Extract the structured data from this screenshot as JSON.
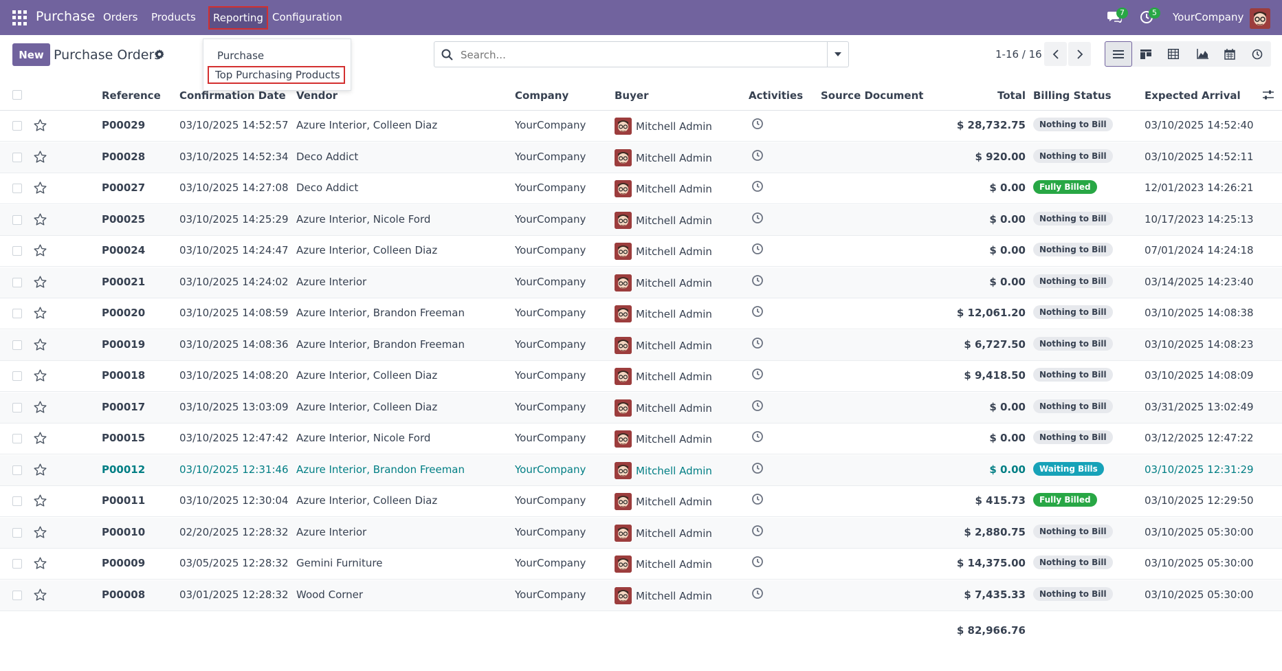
{
  "navbar": {
    "brand": "Purchase",
    "menu": {
      "orders": "Orders",
      "products": "Products",
      "reporting": "Reporting",
      "configuration": "Configuration"
    },
    "chat_count": "7",
    "activity_count": "5",
    "company": "YourCompany"
  },
  "reporting_menu": {
    "purchase": "Purchase",
    "top_products": "Top Purchasing Products"
  },
  "control": {
    "new_label": "New",
    "title": "Purchase Orders",
    "search_placeholder": "Search...",
    "pager": "1-16 / 16"
  },
  "columns": {
    "reference": "Reference",
    "confirmation_date": "Confirmation Date",
    "vendor": "Vendor",
    "company": "Company",
    "buyer": "Buyer",
    "activities": "Activities",
    "source_document": "Source Document",
    "total": "Total",
    "billing_status": "Billing Status",
    "expected_arrival": "Expected Arrival"
  },
  "rows": [
    {
      "ref": "P00029",
      "date": "03/10/2025 14:52:57",
      "vendor": "Azure Interior, Colleen Diaz",
      "company": "YourCompany",
      "buyer": "Mitchell Admin",
      "total": "$ 28,732.75",
      "status": "Nothing to Bill",
      "arrival": "03/10/2025 14:52:40"
    },
    {
      "ref": "P00028",
      "date": "03/10/2025 14:52:34",
      "vendor": "Deco Addict",
      "company": "YourCompany",
      "buyer": "Mitchell Admin",
      "total": "$ 920.00",
      "status": "Nothing to Bill",
      "arrival": "03/10/2025 14:52:11"
    },
    {
      "ref": "P00027",
      "date": "03/10/2025 14:27:08",
      "vendor": "Deco Addict",
      "company": "YourCompany",
      "buyer": "Mitchell Admin",
      "total": "$ 0.00",
      "status": "Fully Billed",
      "arrival": "12/01/2023 14:26:21"
    },
    {
      "ref": "P00025",
      "date": "03/10/2025 14:25:29",
      "vendor": "Azure Interior, Nicole Ford",
      "company": "YourCompany",
      "buyer": "Mitchell Admin",
      "total": "$ 0.00",
      "status": "Nothing to Bill",
      "arrival": "10/17/2023 14:25:13"
    },
    {
      "ref": "P00024",
      "date": "03/10/2025 14:24:47",
      "vendor": "Azure Interior, Colleen Diaz",
      "company": "YourCompany",
      "buyer": "Mitchell Admin",
      "total": "$ 0.00",
      "status": "Nothing to Bill",
      "arrival": "07/01/2024 14:24:18"
    },
    {
      "ref": "P00021",
      "date": "03/10/2025 14:24:02",
      "vendor": "Azure Interior",
      "company": "YourCompany",
      "buyer": "Mitchell Admin",
      "total": "$ 0.00",
      "status": "Nothing to Bill",
      "arrival": "03/14/2025 14:23:40"
    },
    {
      "ref": "P00020",
      "date": "03/10/2025 14:08:59",
      "vendor": "Azure Interior, Brandon Freeman",
      "company": "YourCompany",
      "buyer": "Mitchell Admin",
      "total": "$ 12,061.20",
      "status": "Nothing to Bill",
      "arrival": "03/10/2025 14:08:38"
    },
    {
      "ref": "P00019",
      "date": "03/10/2025 14:08:36",
      "vendor": "Azure Interior, Brandon Freeman",
      "company": "YourCompany",
      "buyer": "Mitchell Admin",
      "total": "$ 6,727.50",
      "status": "Nothing to Bill",
      "arrival": "03/10/2025 14:08:23"
    },
    {
      "ref": "P00018",
      "date": "03/10/2025 14:08:20",
      "vendor": "Azure Interior, Colleen Diaz",
      "company": "YourCompany",
      "buyer": "Mitchell Admin",
      "total": "$ 9,418.50",
      "status": "Nothing to Bill",
      "arrival": "03/10/2025 14:08:09"
    },
    {
      "ref": "P00017",
      "date": "03/10/2025 13:03:09",
      "vendor": "Azure Interior, Colleen Diaz",
      "company": "YourCompany",
      "buyer": "Mitchell Admin",
      "total": "$ 0.00",
      "status": "Nothing to Bill",
      "arrival": "03/31/2025 13:02:49"
    },
    {
      "ref": "P00015",
      "date": "03/10/2025 12:47:42",
      "vendor": "Azure Interior, Nicole Ford",
      "company": "YourCompany",
      "buyer": "Mitchell Admin",
      "total": "$ 0.00",
      "status": "Nothing to Bill",
      "arrival": "03/12/2025 12:47:22"
    },
    {
      "ref": "P00012",
      "date": "03/10/2025 12:31:46",
      "vendor": "Azure Interior, Brandon Freeman",
      "company": "YourCompany",
      "buyer": "Mitchell Admin",
      "total": "$ 0.00",
      "status": "Waiting Bills",
      "arrival": "03/10/2025 12:31:29"
    },
    {
      "ref": "P00011",
      "date": "03/10/2025 12:30:04",
      "vendor": "Azure Interior, Colleen Diaz",
      "company": "YourCompany",
      "buyer": "Mitchell Admin",
      "total": "$ 415.73",
      "status": "Fully Billed",
      "arrival": "03/10/2025 12:29:50"
    },
    {
      "ref": "P00010",
      "date": "02/20/2025 12:28:32",
      "vendor": "Azure Interior",
      "company": "YourCompany",
      "buyer": "Mitchell Admin",
      "total": "$ 2,880.75",
      "status": "Nothing to Bill",
      "arrival": "03/10/2025 05:30:00"
    },
    {
      "ref": "P00009",
      "date": "03/05/2025 12:28:32",
      "vendor": "Gemini Furniture",
      "company": "YourCompany",
      "buyer": "Mitchell Admin",
      "total": "$ 14,375.00",
      "status": "Nothing to Bill",
      "arrival": "03/10/2025 05:30:00"
    },
    {
      "ref": "P00008",
      "date": "03/01/2025 12:28:32",
      "vendor": "Wood Corner",
      "company": "YourCompany",
      "buyer": "Mitchell Admin",
      "total": "$ 7,435.33",
      "status": "Nothing to Bill",
      "arrival": "03/10/2025 05:30:00"
    }
  ],
  "grand_total": "$ 82,966.76",
  "status_colors": {
    "Nothing to Bill": {
      "bg": "#e7e9ed",
      "fg": "#374151"
    },
    "Fully Billed": {
      "bg": "#28a745",
      "fg": "#ffffff"
    },
    "Waiting Bills": {
      "bg": "#17a2b8",
      "fg": "#ffffff"
    }
  },
  "colors": {
    "brand": "#71639e",
    "highlight_text": "#017e84"
  }
}
